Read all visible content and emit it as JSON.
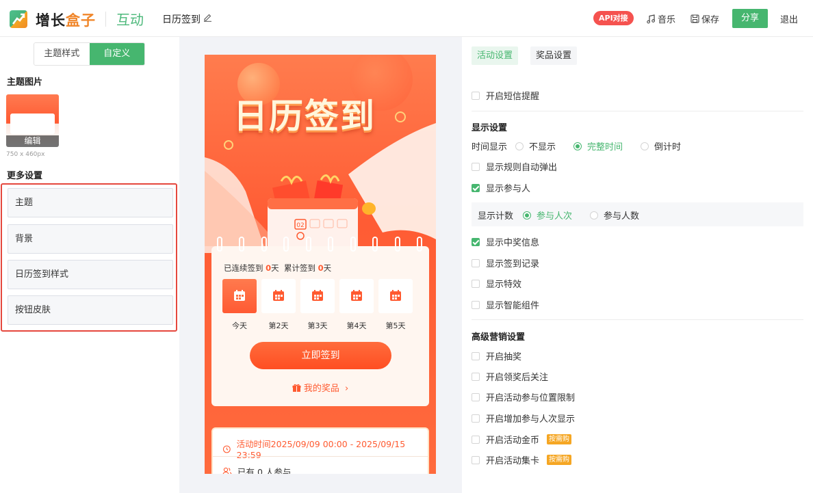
{
  "header": {
    "brand_prefix": "增长",
    "brand_accent": "盒子",
    "module": "互动",
    "doc_title": "日历签到",
    "api_badge": "API对接",
    "music_label": "音乐",
    "save_label": "保存",
    "share_label": "分享",
    "exit_label": "退出"
  },
  "left": {
    "tabs": [
      "主题样式",
      "自定义"
    ],
    "active_tab": "自定义",
    "theme_image_title": "主题图片",
    "thumb_edit": "编辑",
    "thumb_size": "750 x 460px",
    "more_title": "更多设置",
    "more_items": [
      "主题",
      "背景",
      "日历签到样式",
      "按钮皮肤"
    ]
  },
  "preview": {
    "title": "日历签到",
    "calendar_digit": "02",
    "streak_prefix": "已连续签到",
    "streak_days": "0",
    "streak_unit": "天",
    "total_prefix": "累计签到",
    "total_days": "0",
    "total_unit": "天",
    "days": [
      "今天",
      "第2天",
      "第3天",
      "第4天",
      "第5天"
    ],
    "signin_button": "立即签到",
    "my_prizes": "我的奖品",
    "activity_time": "活动时间2025/09/09 00:00 - 2025/09/15 23:59",
    "participants": "已有 0 人参与"
  },
  "right": {
    "tabs": [
      "活动设置",
      "奖品设置"
    ],
    "sms_reminder": "开启短信提醒",
    "display_section": "显示设置",
    "time_display_label": "时间显示",
    "time_display_options": [
      "不显示",
      "完整时间",
      "倒计时"
    ],
    "time_display_selected": "完整时间",
    "show_rules_popup": "显示规则自动弹出",
    "show_participants": "显示参与人",
    "count_label": "显示计数",
    "count_options": [
      "参与人次",
      "参与人数"
    ],
    "count_selected": "参与人次",
    "show_winning_info": "显示中奖信息",
    "show_signin_record": "显示签到记录",
    "show_effects": "显示特效",
    "show_smart_widget": "显示智能组件",
    "advanced_section": "高级营销设置",
    "lottery": "开启抽奖",
    "follow_after_prize": "开启领奖后关注",
    "location_limit": "开启活动参与位置限制",
    "add_participants_display": "开启增加参与人次显示",
    "activity_coins": "开启活动金币",
    "card_collection": "开启活动集卡",
    "paid_tag": "按需购"
  },
  "colors": {
    "brand_green": "#46b66f",
    "brand_orange": "#f0862a",
    "api_red": "#f5524f",
    "highlight_border": "#e5473d",
    "preview_orange": "#ff5a30"
  }
}
